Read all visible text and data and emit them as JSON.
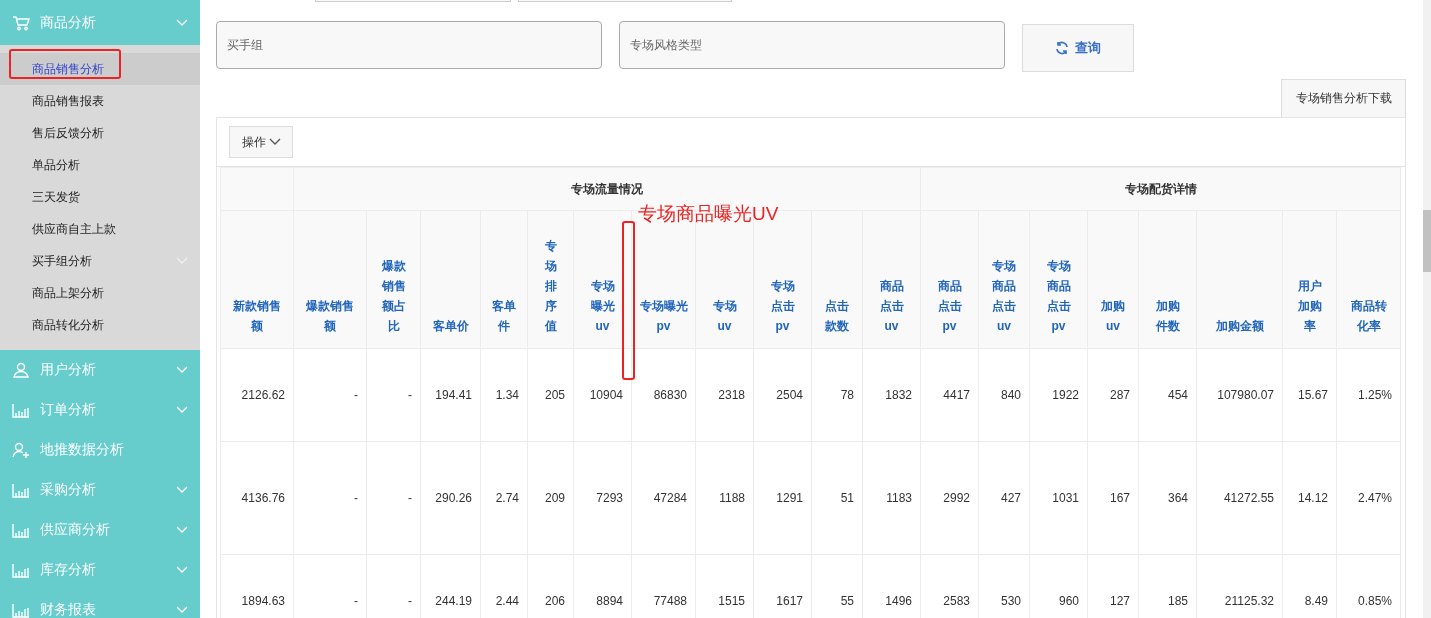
{
  "sidebar": {
    "groups": [
      {
        "label": "商品分析",
        "kind": "cart",
        "expanded": true,
        "chevron": true,
        "children": [
          {
            "label": "商品销售分析",
            "selected": true,
            "chevron": false
          },
          {
            "label": "商品销售报表",
            "selected": false,
            "chevron": false
          },
          {
            "label": "售后反馈分析",
            "selected": false,
            "chevron": false
          },
          {
            "label": "单品分析",
            "selected": false,
            "chevron": false
          },
          {
            "label": "三天发货",
            "selected": false,
            "chevron": false
          },
          {
            "label": "供应商自主上款",
            "selected": false,
            "chevron": false
          },
          {
            "label": "买手组分析",
            "selected": false,
            "chevron": true
          },
          {
            "label": "商品上架分析",
            "selected": false,
            "chevron": false
          },
          {
            "label": "商品转化分析",
            "selected": false,
            "chevron": false
          }
        ]
      },
      {
        "label": "用户分析",
        "kind": "user",
        "chevron": true
      },
      {
        "label": "订单分析",
        "kind": "chart",
        "chevron": true
      },
      {
        "label": "地推数据分析",
        "kind": "user-add",
        "chevron": false
      },
      {
        "label": "采购分析",
        "kind": "chart",
        "chevron": true
      },
      {
        "label": "供应商分析",
        "kind": "chart",
        "chevron": true
      },
      {
        "label": "库存分析",
        "kind": "chart",
        "chevron": true
      },
      {
        "label": "财务报表",
        "kind": "chart",
        "chevron": true
      }
    ]
  },
  "filters": [
    {
      "placeholder": "买手组"
    },
    {
      "placeholder": "专场风格类型"
    }
  ],
  "query_button": {
    "label": "查询"
  },
  "download_button": {
    "label": "专场销售分析下载"
  },
  "actions_button": {
    "label": "操作"
  },
  "table": {
    "column_groups": [
      "专场流量情况",
      "专场配货详情"
    ],
    "columns": [
      "新款销售额",
      "爆款销售额",
      "爆款销售额占比",
      "客单价",
      "客单件",
      "专场排序值",
      "专场曝光uv",
      "专场曝光pv",
      "专场uv",
      "专场点击pv",
      "点击款数",
      "商品点击uv",
      "商品点击pv",
      "专场商品点击uv",
      "专场商品点击pv",
      "加购uv",
      "加购件数",
      "加购金额",
      "用户加购率",
      "商品转化率"
    ],
    "rows": [
      [
        "2126.62",
        "-",
        "-",
        "194.41",
        "1.34",
        "205",
        "10904",
        "86830",
        "2318",
        "2504",
        "78",
        "1832",
        "4417",
        "840",
        "1922",
        "287",
        "454",
        "107980.07",
        "15.67",
        "1.25%"
      ],
      [
        "4136.76",
        "-",
        "-",
        "290.26",
        "2.74",
        "209",
        "7293",
        "47284",
        "1188",
        "1291",
        "51",
        "1183",
        "2992",
        "427",
        "1031",
        "167",
        "364",
        "41272.55",
        "14.12",
        "2.47%"
      ],
      [
        "1894.63",
        "-",
        "-",
        "244.19",
        "2.44",
        "206",
        "8894",
        "77488",
        "1515",
        "1617",
        "55",
        "1496",
        "2583",
        "530",
        "960",
        "127",
        "185",
        "21125.32",
        "8.49",
        "0.85%"
      ]
    ]
  },
  "annotation": {
    "text": "专场商品曝光UV"
  }
}
